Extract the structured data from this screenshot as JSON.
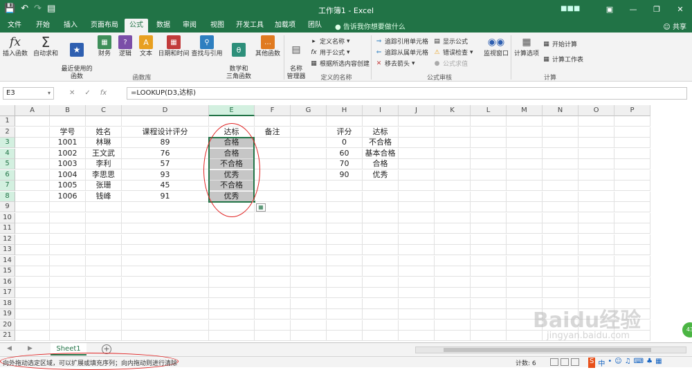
{
  "window": {
    "title": "工作簿1 - Excel",
    "user": "■■■"
  },
  "tabs": [
    "文件",
    "开始",
    "插入",
    "页面布局",
    "公式",
    "数据",
    "审阅",
    "视图",
    "开发工具",
    "加载项",
    "团队"
  ],
  "active_tab": "公式",
  "search_placeholder": "告诉我你想要做什么",
  "share_label": "共享",
  "ribbon": {
    "insert_function": "插入函数",
    "autosum": "自动求和",
    "recent": "最近使用的\n函数",
    "financial": "财务",
    "logical": "逻辑",
    "text": "文本",
    "datetime": "日期和时间",
    "lookup": "查找与引用",
    "math": "数学和\n三角函数",
    "more": "其他函数",
    "group_library": "函数库",
    "name_manager": "名称\n管理器",
    "define_name": "定义名称",
    "use_in_formula": "用于公式",
    "create_from_sel": "根据所选内容创建",
    "group_names": "定义的名称",
    "trace_precedents": "追踪引用单元格",
    "trace_dependents": "追踪从属单元格",
    "remove_arrows": "移去箭头",
    "show_formulas": "显示公式",
    "error_checking": "错误检查",
    "evaluate": "公式求值",
    "group_audit": "公式审核",
    "watch_window": "监视窗口",
    "calc_options": "计算选项",
    "calc_now": "开始计算",
    "calc_sheet": "计算工作表",
    "group_calc": "计算"
  },
  "formula_bar": {
    "name_box": "E3",
    "formula": "=LOOKUP(D3,达标)"
  },
  "columns": [
    "A",
    "B",
    "C",
    "D",
    "E",
    "F",
    "G",
    "H",
    "I",
    "J",
    "K",
    "L",
    "M",
    "N",
    "O",
    "P"
  ],
  "rows": [
    "1",
    "2",
    "3",
    "4",
    "5",
    "6",
    "7",
    "8",
    "9",
    "10",
    "11",
    "12",
    "13",
    "14",
    "15",
    "16",
    "17",
    "18",
    "19",
    "20",
    "21"
  ],
  "table": {
    "headers": [
      "学号",
      "姓名",
      "课程设计评分",
      "达标",
      "备注"
    ],
    "rows": [
      [
        "1001",
        "林琳",
        "89",
        "合格"
      ],
      [
        "1002",
        "王文武",
        "76",
        "合格"
      ],
      [
        "1003",
        "李利",
        "57",
        "不合格"
      ],
      [
        "1004",
        "李思思",
        "93",
        "优秀"
      ],
      [
        "1005",
        "张珊",
        "45",
        "不合格"
      ],
      [
        "1006",
        "钱峰",
        "91",
        "优秀"
      ]
    ]
  },
  "lookup": {
    "headers": [
      "评分",
      "达标"
    ],
    "rows": [
      [
        "0",
        "不合格"
      ],
      [
        "60",
        "基本合格"
      ],
      [
        "70",
        "合格"
      ],
      [
        "90",
        "优秀"
      ]
    ]
  },
  "sheet_tab": "Sheet1",
  "status": {
    "message": "向外拖动选定区域，可以扩展或填充序列；向内拖动则进行清除",
    "count": "计数: 6"
  },
  "watermark": {
    "brand": "Baidu经验",
    "url": "jingyan.baidu.com"
  },
  "float_badge": "43"
}
